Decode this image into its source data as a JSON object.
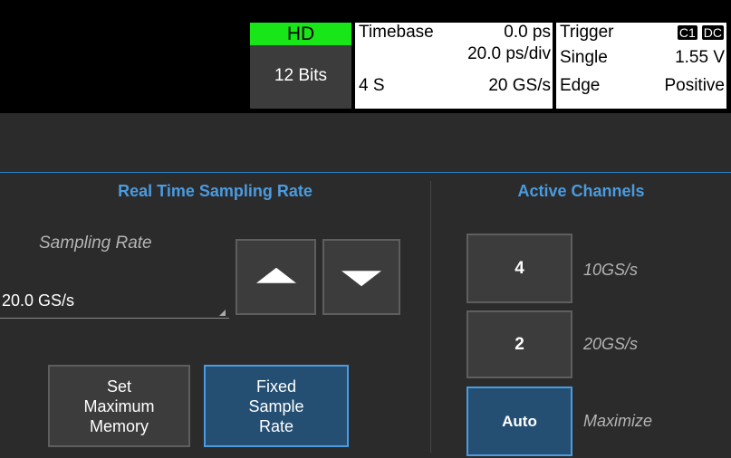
{
  "status": {
    "hd_label": "HD",
    "bits": "12 Bits",
    "timebase": {
      "label": "Timebase",
      "delay": "0.0 ps",
      "per_div": "20.0 ps/div",
      "segments": "4 S",
      "sample_rate": "20 GS/s"
    },
    "trigger": {
      "label": "Trigger",
      "source": "C1",
      "coupling": "DC",
      "mode": "Single",
      "level": "1.55 V",
      "type": "Edge",
      "slope": "Positive"
    }
  },
  "sampling": {
    "title": "Real Time Sampling Rate",
    "rate_label": "Sampling Rate",
    "rate_value": "20.0 GS/s",
    "buttons": {
      "set_max_memory": "Set Maximum Memory",
      "fixed_sample_rate": "Fixed Sample Rate"
    }
  },
  "channels": {
    "title": "Active Channels",
    "options": [
      {
        "label": "4",
        "desc": "10GS/s"
      },
      {
        "label": "2",
        "desc": "20GS/s"
      },
      {
        "label": "Auto",
        "desc": "Maximize"
      }
    ]
  },
  "colors": {
    "accent": "#4a9be0",
    "hd_green": "#19e619",
    "selected_fill": "#244f73",
    "panel_bg": "#2b2b2b"
  }
}
